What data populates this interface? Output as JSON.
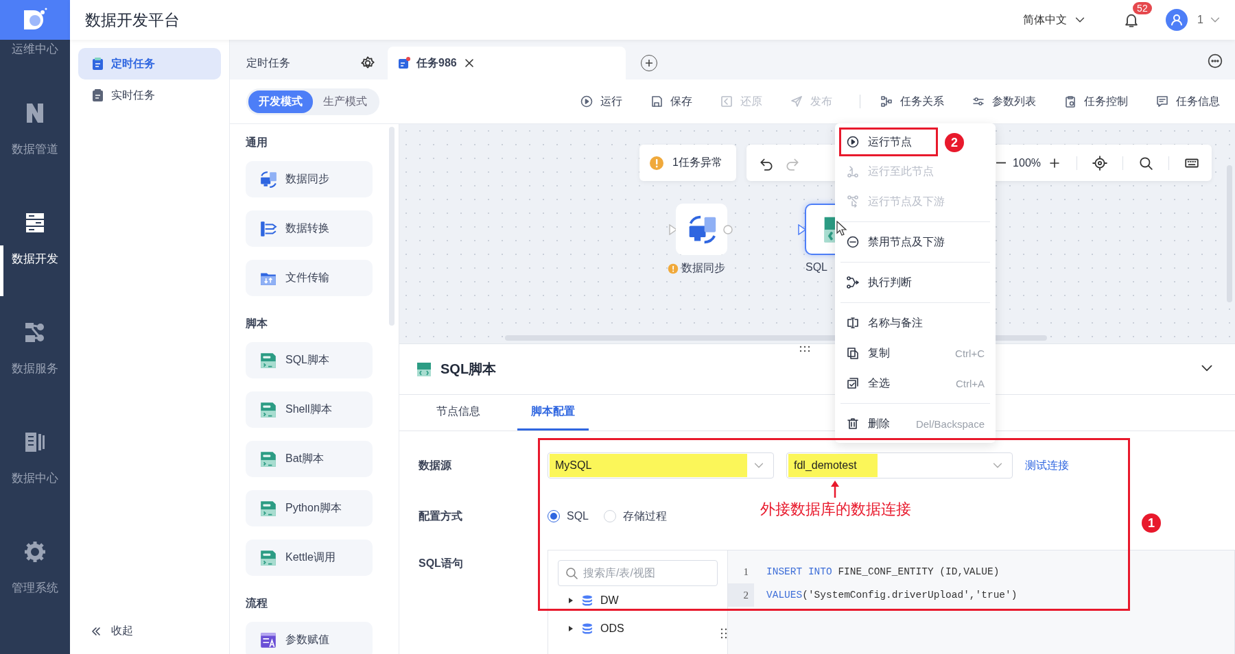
{
  "rail": {
    "items": [
      {
        "label": "运维中心",
        "selected": false
      },
      {
        "label": "数据管道",
        "selected": false
      },
      {
        "label": "数据开发",
        "selected": true
      },
      {
        "label": "数据服务",
        "selected": false
      },
      {
        "label": "数据中心",
        "selected": false
      },
      {
        "label": "管理系统",
        "selected": false
      }
    ]
  },
  "header": {
    "title": "数据开发平台",
    "language": "简体中文",
    "notifications": "52",
    "user": "1"
  },
  "subnav": {
    "items": [
      {
        "label": "定时任务",
        "selected": true
      },
      {
        "label": "实时任务",
        "selected": false
      }
    ],
    "collapse": "收起"
  },
  "tabs": [
    {
      "label": "定时任务",
      "selected": false
    },
    {
      "label": "任务986",
      "selected": true
    }
  ],
  "modes": [
    {
      "label": "开发模式",
      "selected": true
    },
    {
      "label": "生产模式",
      "selected": false
    }
  ],
  "toolbar": [
    {
      "label": "运行",
      "disabled": false,
      "divider_before": false
    },
    {
      "label": "保存",
      "disabled": false,
      "divider_before": false
    },
    {
      "label": "还原",
      "disabled": true,
      "divider_before": false
    },
    {
      "label": "发布",
      "disabled": true,
      "divider_before": false
    },
    {
      "label": "任务关系",
      "disabled": false,
      "divider_before": true
    },
    {
      "label": "参数列表",
      "disabled": false,
      "divider_before": false
    },
    {
      "label": "任务控制",
      "disabled": false,
      "divider_before": false
    },
    {
      "label": "任务信息",
      "disabled": false,
      "divider_before": false
    }
  ],
  "palette": [
    {
      "title": "通用",
      "items": [
        "数据同步",
        "数据转换",
        "文件传输"
      ]
    },
    {
      "title": "脚本",
      "items": [
        "SQL脚本",
        "Shell脚本",
        "Bat脚本",
        "Python脚本",
        "Kettle调用"
      ]
    },
    {
      "title": "流程",
      "items": [
        "参数赋值"
      ]
    }
  ],
  "canvas": {
    "alert": "1任务异常",
    "zoom": "100%",
    "nodes": [
      {
        "label": "数据同步",
        "warning": true,
        "selected": false
      },
      {
        "label": "SQL",
        "warning": false,
        "selected": true
      }
    ]
  },
  "context_menu": [
    {
      "label": "运行节点",
      "disabled": false,
      "divider_before": false,
      "outlined": true
    },
    {
      "label": "运行至此节点",
      "disabled": true,
      "divider_before": false
    },
    {
      "label": "运行节点及下游",
      "disabled": true,
      "divider_before": false
    },
    {
      "label": "禁用节点及下游",
      "disabled": false,
      "divider_before": true
    },
    {
      "label": "执行判断",
      "disabled": false,
      "divider_before": true
    },
    {
      "label": "名称与备注",
      "disabled": false,
      "divider_before": true
    },
    {
      "label": "复制",
      "disabled": false,
      "divider_before": false,
      "shortcut": "Ctrl+C"
    },
    {
      "label": "全选",
      "disabled": false,
      "divider_before": false,
      "shortcut": "Ctrl+A"
    },
    {
      "label": "删除",
      "disabled": false,
      "divider_before": true,
      "shortcut": "Del/Backspace"
    }
  ],
  "panel": {
    "title": "SQL脚本",
    "tabs": [
      {
        "label": "节点信息",
        "selected": false
      },
      {
        "label": "脚本配置",
        "selected": true
      }
    ],
    "source": {
      "label": "数据源",
      "type": {
        "value": "MySQL",
        "highlighted": true
      },
      "database": {
        "value": "fdl_demotest",
        "highlighted": true
      },
      "test_link": "测试连接"
    },
    "mode": {
      "label": "配置方式",
      "options": [
        {
          "label": "SQL",
          "selected": true
        },
        {
          "label": "存储过程",
          "selected": false
        }
      ]
    },
    "sql": {
      "label": "SQL语句",
      "search_placeholder": "搜索库/表/视图",
      "tree": [
        {
          "label": "DW",
          "expanded": false
        },
        {
          "label": "ODS",
          "expanded": false
        }
      ],
      "lines": [
        {
          "number": "1",
          "current": false,
          "tokens": [
            {
              "text": "INSERT INTO",
              "kind": "keyword"
            },
            {
              "text": " FINE_CONF_ENTITY (ID,VALUE)",
              "kind": "plain"
            }
          ]
        },
        {
          "number": "2",
          "current": true,
          "tokens": [
            {
              "text": "VALUES",
              "kind": "keyword"
            },
            {
              "text": "('SystemConfig.driverUpload','true')",
              "kind": "plain"
            }
          ]
        }
      ]
    }
  },
  "annotations": {
    "note": "外接数据库的数据连接",
    "markers": [
      "1",
      "2"
    ]
  }
}
